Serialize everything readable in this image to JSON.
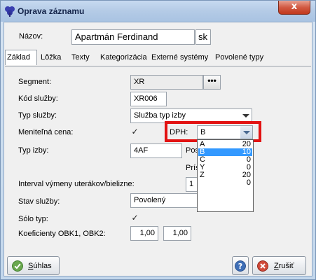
{
  "window": {
    "title": "Oprava záznamu",
    "close_glyph": "x",
    "icon": "app-clover-icon"
  },
  "header": {
    "name_label": "Názov:",
    "name_value": "Apartmán Ferdinand",
    "lang_value": "sk"
  },
  "tabs": [
    {
      "label": "Základ",
      "active": true
    },
    {
      "label": "Lôžka"
    },
    {
      "label": "Texty"
    },
    {
      "label": "Kategorizácia"
    },
    {
      "label": "Externé systémy"
    },
    {
      "label": "Povolené typy"
    }
  ],
  "form": {
    "segment_label": "Segment:",
    "segment_value": "XR",
    "segment_button": "•••",
    "code_label": "Kód služby:",
    "code_value": "XR006",
    "type_label": "Typ služby:",
    "type_value": "Služba typ izby",
    "variable_price_label": "Meniteľná cena:",
    "variable_price_checked": "✓",
    "vat_label": "DPH:",
    "vat_value": "B",
    "room_type_label": "Typ izby:",
    "room_type_value": "4AF",
    "post_label_partial": "Pos",
    "pris_label_partial": "Príst",
    "interval_label": "Interval výmeny uterákov/bielizne:",
    "interval_value": "1",
    "status_label": "Stav služby:",
    "status_value": "Povolený",
    "solo_label": "Sólo typ:",
    "solo_checked": "✓",
    "coef_label": "Koeficienty OBK1, OBK2:",
    "coef1": "1,00",
    "coef2": "1,00"
  },
  "vat_dropdown": [
    {
      "code": "A",
      "rate": "20"
    },
    {
      "code": "B",
      "rate": "10",
      "selected": true
    },
    {
      "code": "C",
      "rate": "0"
    },
    {
      "code": "Y",
      "rate": "0"
    },
    {
      "code": "Z",
      "rate": "20"
    },
    {
      "code": "",
      "rate": "0"
    }
  ],
  "buttons": {
    "ok_prefix": "S",
    "ok_rest": "úhlas",
    "cancel_prefix": "Z",
    "cancel_rest": "rušiť",
    "help_glyph": "?"
  },
  "colors": {
    "highlight": "#e21212",
    "selection": "#3399ff"
  }
}
